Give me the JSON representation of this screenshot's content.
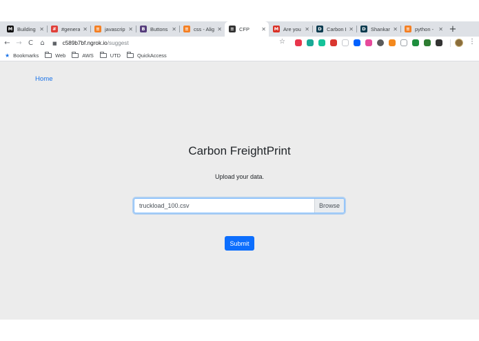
{
  "browser": {
    "tabs": [
      {
        "title": "Building",
        "icon": "medium-icon",
        "icon_text": "M",
        "icon_color": "#111111",
        "active": false
      },
      {
        "title": "#general",
        "icon": "slack-icon",
        "icon_text": "#",
        "icon_color": "#e0403a",
        "active": false
      },
      {
        "title": "javascript",
        "icon": "stackoverflow-icon",
        "icon_text": "≡",
        "icon_color": "#f48024",
        "active": false
      },
      {
        "title": "Buttons",
        "icon": "bootstrap-icon",
        "icon_text": "B",
        "icon_color": "#563d7c",
        "active": false
      },
      {
        "title": "css - Alig",
        "icon": "stackoverflow-icon",
        "icon_text": "≡",
        "icon_color": "#f48024",
        "active": false
      },
      {
        "title": "CFP",
        "icon": "ngrok-icon",
        "icon_text": "≡",
        "icon_color": "#333333",
        "active": true
      },
      {
        "title": "Are you p",
        "icon": "gmail-icon",
        "icon_text": "M",
        "icon_color": "#d93025",
        "active": false
      },
      {
        "title": "Carbon F",
        "icon": "d-icon",
        "icon_text": "D",
        "icon_color": "#0b3b4f",
        "active": false
      },
      {
        "title": "Shankara",
        "icon": "d-icon",
        "icon_text": "D",
        "icon_color": "#0b3b4f",
        "active": false
      },
      {
        "title": "python -",
        "icon": "stackoverflow-icon",
        "icon_text": "≡",
        "icon_color": "#f48024",
        "active": false
      }
    ],
    "new_tab_symbol": "+",
    "close_symbol": "✕",
    "nav": {
      "back": "←",
      "forward": "→",
      "reload": "C",
      "home": "⌂"
    },
    "url": {
      "lock": "🔒",
      "host": "c589b7bf.ngrok.io",
      "path": "/suggest"
    },
    "star_symbol": "☆",
    "menu_symbol": "⋮",
    "extensions": [
      {
        "name": "ext-pocket-icon",
        "color": "#e8364c"
      },
      {
        "name": "ext-teal-icon",
        "color": "#19a996"
      },
      {
        "name": "ext-grammarly-icon",
        "color": "#15c39a"
      },
      {
        "name": "ext-red-icon",
        "color": "#d9362f"
      },
      {
        "name": "ext-gray-icon",
        "color": "#c4c7cc"
      },
      {
        "name": "ext-dropbox-icon",
        "color": "#0061fe"
      },
      {
        "name": "ext-pink-icon",
        "color": "#e64a9b"
      },
      {
        "name": "ext-dark-icon",
        "color": "#5a5a5a"
      },
      {
        "name": "ext-orange-icon",
        "color": "#f4891e"
      },
      {
        "name": "ext-outline-icon",
        "color": "#9aa0a6"
      },
      {
        "name": "ext-green-icon",
        "color": "#1e8e3e"
      },
      {
        "name": "ext-vue-icon",
        "color": "#2e7d32"
      },
      {
        "name": "ext-notion-icon",
        "color": "#333333"
      }
    ],
    "bookmarks": [
      {
        "label": "Bookmarks",
        "icon": "star-icon"
      },
      {
        "label": "Web",
        "icon": "folder-icon"
      },
      {
        "label": "AWS",
        "icon": "folder-icon"
      },
      {
        "label": "UTD",
        "icon": "folder-icon"
      },
      {
        "label": "QuickAccess",
        "icon": "folder-icon"
      }
    ]
  },
  "page": {
    "home_link": "Home",
    "title": "Carbon FreightPrint",
    "subtitle": "Upload your data.",
    "file_input": {
      "value": "truckload_100.csv",
      "browse_label": "Browse"
    },
    "submit_label": "Submit",
    "accent_color": "#0d6efd"
  }
}
